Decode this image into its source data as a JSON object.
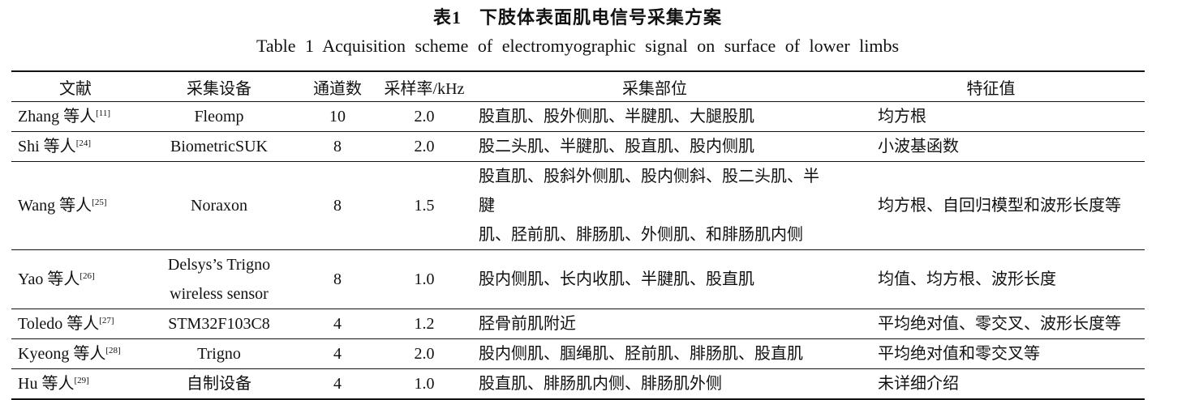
{
  "caption": {
    "number_cn": "表1",
    "title_cn": "下肢体表面肌电信号采集方案",
    "title_en": "Table 1   Acquisition scheme of electromyographic signal on surface of lower limbs"
  },
  "table": {
    "headers": [
      "文献",
      "采集设备",
      "通道数",
      "采样率/kHz",
      "采集部位",
      "特征值"
    ],
    "rows": [
      {
        "ref": "Zhang 等人",
        "cite": "[11]",
        "device": "Fleomp",
        "device_line2": "",
        "channels": "10",
        "rate": "2.0",
        "site": "股直肌、股外侧肌、半腱肌、大腿股肌",
        "site_line2": "",
        "feature": "均方根"
      },
      {
        "ref": "Shi 等人",
        "cite": "[24]",
        "device": "BiometricSUK",
        "device_line2": "",
        "channels": "8",
        "rate": "2.0",
        "site": "股二头肌、半腱肌、股直肌、股内侧肌",
        "site_line2": "",
        "feature": "小波基函数"
      },
      {
        "ref": "Wang 等人",
        "cite": "[25]",
        "device": "Noraxon",
        "device_line2": "",
        "channels": "8",
        "rate": "1.5",
        "site": "股直肌、股斜外侧肌、股内侧斜、股二头肌、半腱",
        "site_line2": "肌、胫前肌、腓肠肌、外侧肌、和腓肠肌内侧",
        "feature": "均方根、自回归模型和波形长度等"
      },
      {
        "ref": "Yao 等人",
        "cite": "[26]",
        "device": "Delsys’s Trigno",
        "device_line2": "wireless sensor",
        "channels": "8",
        "rate": "1.0",
        "site": "股内侧肌、长内收肌、半腱肌、股直肌",
        "site_line2": "",
        "feature": "均值、均方根、波形长度"
      },
      {
        "ref": "Toledo 等人",
        "cite": "[27]",
        "device": "STM32F103C8",
        "device_line2": "",
        "channels": "4",
        "rate": "1.2",
        "site": "胫骨前肌附近",
        "site_line2": "",
        "feature": "平均绝对值、零交叉、波形长度等"
      },
      {
        "ref": "Kyeong 等人",
        "cite": "[28]",
        "device": "Trigno",
        "device_line2": "",
        "channels": "4",
        "rate": "2.0",
        "site": "股内侧肌、腘绳肌、胫前肌、腓肠肌、股直肌",
        "site_line2": "",
        "feature": "平均绝对值和零交叉等"
      },
      {
        "ref": "Hu 等人",
        "cite": "[29]",
        "device": "自制设备",
        "device_line2": "",
        "channels": "4",
        "rate": "1.0",
        "site": "股直肌、腓肠肌内侧、腓肠肌外侧",
        "site_line2": "",
        "feature": "未详细介绍"
      }
    ]
  }
}
